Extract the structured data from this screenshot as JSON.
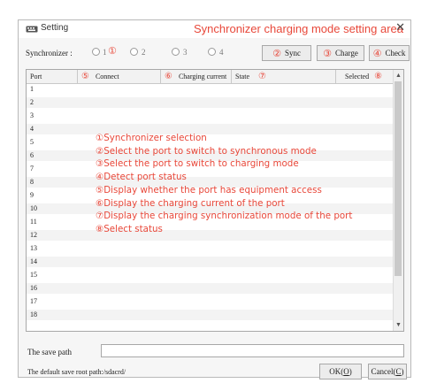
{
  "window": {
    "title": "Setting",
    "annotation_title": "Synchronizer charging mode setting area",
    "close_glyph": "✕",
    "app_icon": "keyboard-icon"
  },
  "toolbar": {
    "synchronizer_label": "Synchronizer :",
    "radios": [
      {
        "label": "1",
        "selected": false
      },
      {
        "label": "2",
        "selected": false
      },
      {
        "label": "3",
        "selected": false
      },
      {
        "label": "4",
        "selected": false
      }
    ],
    "sync_button": "Sync",
    "charge_button": "Charge",
    "check_button": "Check"
  },
  "markers": {
    "m1": "①",
    "m2": "②",
    "m3": "③",
    "m4": "④",
    "m5": "⑤",
    "m6": "⑥",
    "m7": "⑦",
    "m8": "⑧"
  },
  "table": {
    "columns": [
      "Port",
      "Connect",
      "Charging current",
      "State",
      "Selected"
    ],
    "rows": [
      "1",
      "2",
      "3",
      "4",
      "5",
      "6",
      "7",
      "8",
      "9",
      "10",
      "11",
      "12",
      "13",
      "14",
      "15",
      "16",
      "17",
      "18"
    ]
  },
  "notes": [
    "①Synchronizer selection",
    "②Select the port to switch to synchronous mode",
    "③Select the port to switch to charging mode",
    "④Detect port status",
    "⑤Display whether the port has equipment access",
    "⑥Display the charging current of the port",
    "⑦Display the charging synchronization mode of the port",
    "⑧Select status"
  ],
  "footer": {
    "save_path_label": "The save path",
    "save_path_value": "",
    "default_root_text": "The default save root path:/sdacrd/",
    "ok_label": "OK(",
    "ok_key": "O",
    "cancel_label": "Cancel(",
    "cancel_key": "C",
    "close_paren": ")"
  },
  "colors": {
    "annotation": "#e8483a",
    "window_bg": "#f6f6f6",
    "row_alt": "#f3f3f3"
  }
}
